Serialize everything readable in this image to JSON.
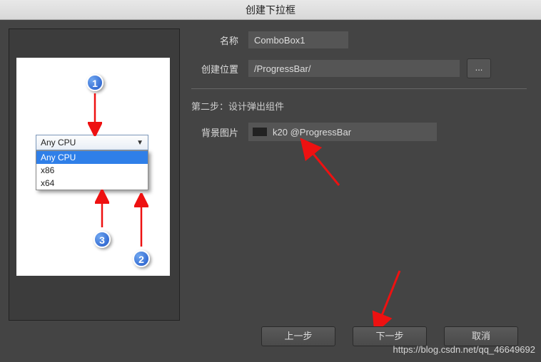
{
  "title": "创建下拉框",
  "form": {
    "nameLabel": "名称",
    "nameValue": "ComboBox1",
    "pathLabel": "创建位置",
    "pathValue": "/ProgressBar/",
    "browseLabel": "...",
    "stepTitle": "第二步：设计弹出组件",
    "bgImgLabel": "背景图片",
    "bgImgValue": "k20 @ProgressBar"
  },
  "preview": {
    "comboValue": "Any CPU",
    "options": [
      "Any CPU",
      "x86",
      "x64"
    ],
    "badge1": "1",
    "badge2": "2",
    "badge3": "3"
  },
  "buttons": {
    "prev": "上一步",
    "next": "下一步",
    "cancel": "取消"
  },
  "watermark": "https://blog.csdn.net/qq_46649692"
}
